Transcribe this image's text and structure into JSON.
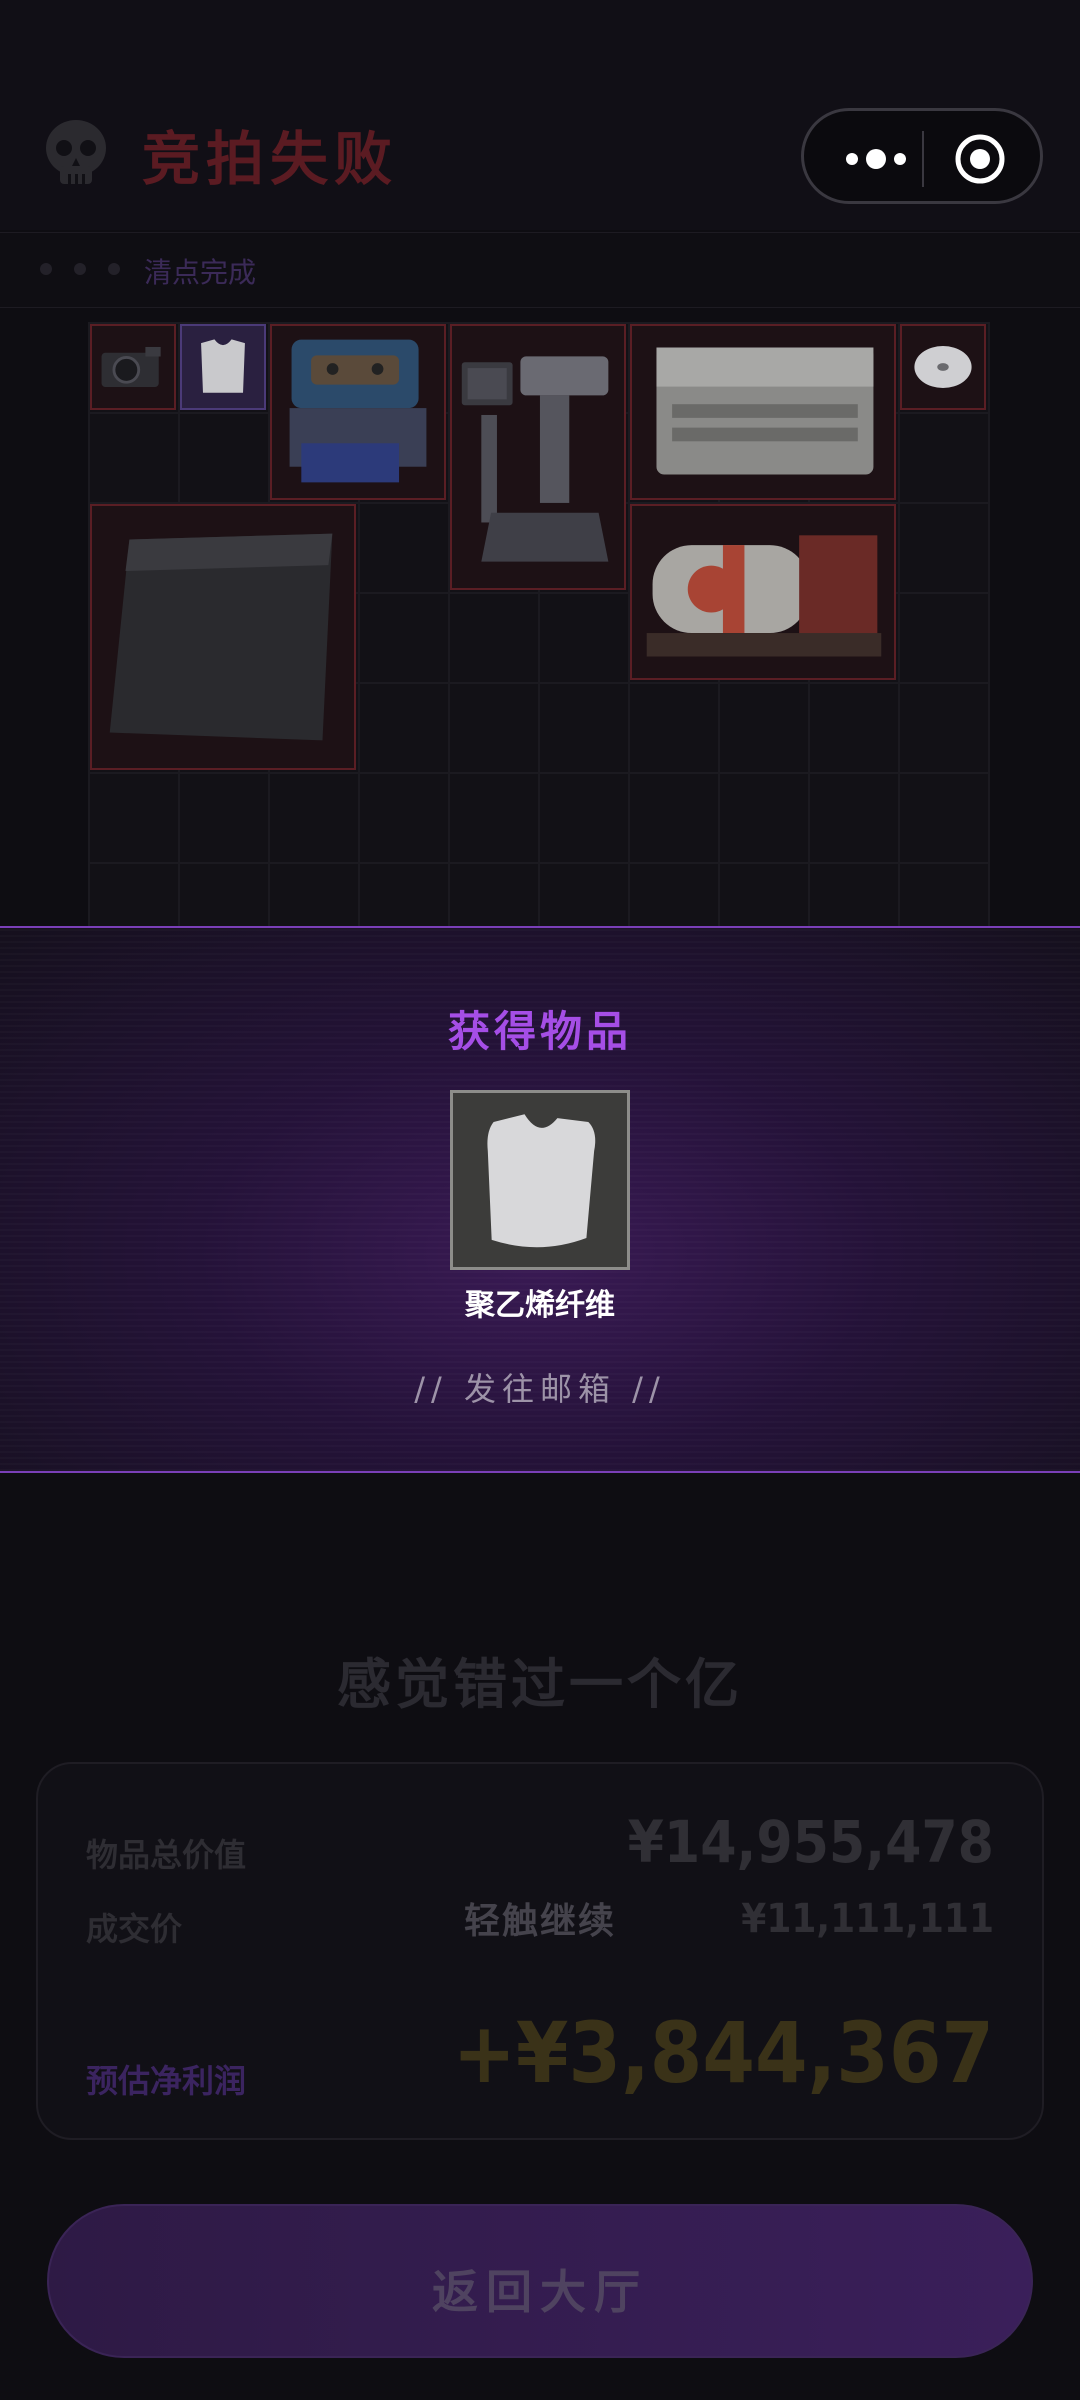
{
  "header": {
    "title": "竞拍失败",
    "skull_icon": "skull-icon",
    "status_text": "清点完成",
    "capsule": {
      "more_icon": "more-dots-icon",
      "close_icon": "target-circle-icon"
    }
  },
  "inventory": {
    "items": [
      {
        "name": "camera-item",
        "icon": "camera-icon"
      },
      {
        "name": "vest-item",
        "icon": "vest-icon"
      },
      {
        "name": "engine-item",
        "icon": "engine-icon"
      },
      {
        "name": "robot-arm-item",
        "icon": "robot-icon"
      },
      {
        "name": "battery-item",
        "icon": "battery-icon"
      },
      {
        "name": "disc-item",
        "icon": "disc-icon"
      },
      {
        "name": "carbon-plate-item",
        "icon": "plate-icon"
      },
      {
        "name": "tank-item",
        "icon": "tank-icon"
      }
    ]
  },
  "popup": {
    "title": "获得物品",
    "reward_name": "聚乙烯纤维",
    "reward_icon": "vest-icon",
    "mailbox_text": "// 发往邮箱 //"
  },
  "summary": {
    "slogan": "感觉错过一个亿",
    "total_label": "物品总价值",
    "total_value": "¥14,955,478",
    "deal_label": "成交价",
    "deal_value": "¥11,111,111",
    "tap_hint": "轻触继续",
    "profit_label": "预估净利润",
    "profit_value": "+¥3,844,367"
  },
  "back_button": {
    "label": "返回大厅"
  },
  "colors": {
    "accent_purple": "#a54ee6",
    "danger_red": "#5b1b22",
    "profit_gold": "#3a3218"
  }
}
